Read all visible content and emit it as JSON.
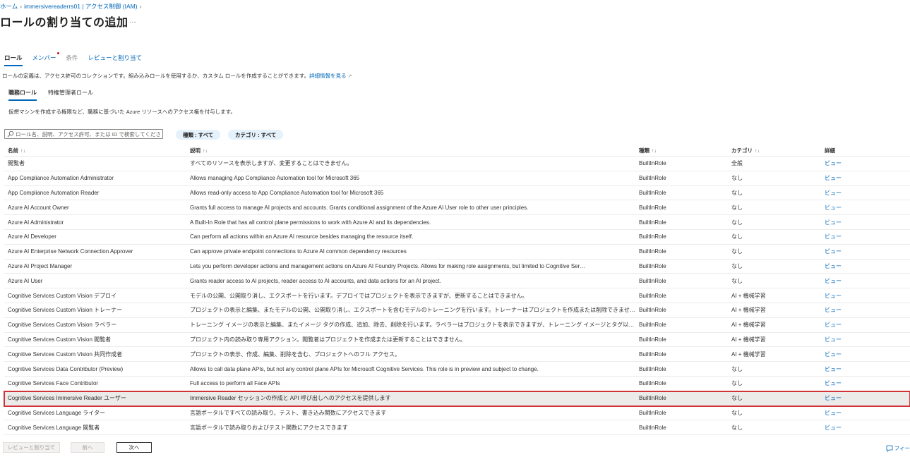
{
  "breadcrumb": {
    "home": "ホーム",
    "resource": "immersivereaderrs01 | アクセス制御 (IAM)"
  },
  "page": {
    "title": "ロールの割り当ての追加",
    "more": "…"
  },
  "tabs": [
    {
      "label": "ロール",
      "state": "active"
    },
    {
      "label": "メンバー",
      "state": "required"
    },
    {
      "label": "条件",
      "state": "disabled"
    },
    {
      "label": "レビューと割り当て",
      "state": "link"
    }
  ],
  "description": {
    "text": "ロールの定義は、アクセス許可のコレクションです。組み込みロールを使用するか、カスタム ロールを作成することができます。",
    "link": "詳細情報を見る"
  },
  "subtabs": [
    {
      "label": "職務ロール",
      "state": "active"
    },
    {
      "label": "特権管理者ロール",
      "state": "normal"
    }
  ],
  "sub_description": "仮想マシンを作成する権限など、職務に基づいた Azure リソースへのアクセス権を付与します。",
  "search": {
    "placeholder": "ロール名、説明、アクセス許可、または ID で検索してください"
  },
  "filters": {
    "type": "種類 : すべて",
    "category": "カテゴリ : すべて"
  },
  "table": {
    "columns": {
      "name": "名前",
      "description": "説明",
      "type": "種類",
      "category": "カテゴリ",
      "details": "詳細"
    },
    "sort_glyph": "↑↓",
    "rows": [
      {
        "name": "閲覧者",
        "description": "すべてのリソースを表示しますが、変更することはできません。",
        "type": "BuiltInRole",
        "category": "全般",
        "details": "ビュー"
      },
      {
        "name": "App Compliance Automation Administrator",
        "description": "Allows managing App Compliance Automation tool for Microsoft 365",
        "type": "BuiltInRole",
        "category": "なし",
        "details": "ビュー"
      },
      {
        "name": "App Compliance Automation Reader",
        "description": "Allows read-only access to App Compliance Automation tool for Microsoft 365",
        "type": "BuiltInRole",
        "category": "なし",
        "details": "ビュー"
      },
      {
        "name": "Azure AI Account Owner",
        "description": "Grants full access to manage AI projects and accounts. Grants conditional assignment of the Azure AI User role to other user principles.",
        "type": "BuiltInRole",
        "category": "なし",
        "details": "ビュー"
      },
      {
        "name": "Azure AI Administrator",
        "description": "A Built-In Role that has all control plane permissions to work with Azure AI and its dependencies.",
        "type": "BuiltInRole",
        "category": "なし",
        "details": "ビュー"
      },
      {
        "name": "Azure AI Developer",
        "description": "Can perform all actions within an Azure AI resource besides managing the resource itself.",
        "type": "BuiltInRole",
        "category": "なし",
        "details": "ビュー"
      },
      {
        "name": "Azure AI Enterprise Network Connection Approver",
        "description": "Can approve private endpoint connections to Azure AI common dependency resources",
        "type": "BuiltInRole",
        "category": "なし",
        "details": "ビュー"
      },
      {
        "name": "Azure AI Project Manager",
        "description": "Lets you perform developer actions and management actions on Azure AI Foundry Projects. Allows for making role assignments, but limited to Cognitive Ser…",
        "type": "BuiltInRole",
        "category": "なし",
        "details": "ビュー"
      },
      {
        "name": "Azure AI User",
        "description": "Grants reader access to AI projects, reader access to AI accounts, and data actions for an AI project.",
        "type": "BuiltInRole",
        "category": "なし",
        "details": "ビュー"
      },
      {
        "name": "Cognitive Services Custom Vision デプロイ",
        "description": "モデルの公開、公開取り消し、エクスポートを行います。デプロイではプロジェクトを表示できますが、更新することはできません。",
        "type": "BuiltInRole",
        "category": "AI + 機械学習",
        "details": "ビュー"
      },
      {
        "name": "Cognitive Services Custom Vision トレーナー",
        "description": "プロジェクトの表示と編集、またモデルの公開、公開取り消し、エクスポートを含むモデルのトレーニングを行います。トレーナーはプロジェクトを作成または削除できません。",
        "type": "BuiltInRole",
        "category": "AI + 機械学習",
        "details": "ビュー"
      },
      {
        "name": "Cognitive Services Custom Vision ラベラー",
        "description": "トレーニング イメージの表示と編集、またイメージ タグの作成、追加、除去、削除を行います。ラベラーはプロジェクトを表示できますが、トレーニング イメージとタグ以外は更新できません。",
        "type": "BuiltInRole",
        "category": "AI + 機械学習",
        "details": "ビュー"
      },
      {
        "name": "Cognitive Services Custom Vision 閲覧者",
        "description": "プロジェクト内の読み取り専用アクション。閲覧者はプロジェクトを作成または更新することはできません。",
        "type": "BuiltInRole",
        "category": "AI + 機械学習",
        "details": "ビュー"
      },
      {
        "name": "Cognitive Services Custom Vision 共同作成者",
        "description": "プロジェクトの表示、作成、編集、削除を含む、プロジェクトへのフル アクセス。",
        "type": "BuiltInRole",
        "category": "AI + 機械学習",
        "details": "ビュー"
      },
      {
        "name": "Cognitive Services Data Contributor (Preview)",
        "description": "Allows to call data plane APIs, but not any control plane APIs for Microsoft Cognitive Services. This role is in preview and subject to change.",
        "type": "BuiltInRole",
        "category": "なし",
        "details": "ビュー"
      },
      {
        "name": "Cognitive Services Face Contributor",
        "description": "Full access to perform all Face APIs",
        "type": "BuiltInRole",
        "category": "なし",
        "details": "ビュー"
      },
      {
        "name": "Cognitive Services Immersive Reader ユーザー",
        "description": "Immersive Reader セッションの作成と API 呼び出しへのアクセスを提供します",
        "type": "BuiltInRole",
        "category": "なし",
        "details": "ビュー",
        "selected": true
      },
      {
        "name": "Cognitive Services Language ライター",
        "description": "言語ポータルですべての読み取り、テスト、書き込み関数にアクセスできます",
        "type": "BuiltInRole",
        "category": "なし",
        "details": "ビュー"
      },
      {
        "name": "Cognitive Services Language 閲覧者",
        "description": "言語ポータルで読み取りおよびテスト関数にアクセスできます",
        "type": "BuiltInRole",
        "category": "なし",
        "details": "ビュー"
      }
    ]
  },
  "footer": {
    "review_button": "レビューと割り当て",
    "prev_button": "前へ",
    "next_button": "次へ",
    "feedback": "フィー"
  },
  "icons": {
    "search": "search-icon",
    "feedback": "feedback-icon",
    "external_link": "external-link-icon"
  },
  "colors": {
    "link": "#0067b8",
    "selected_row_border": "#d13438",
    "filter_pill_bg": "#e5f1fb",
    "required_dot": "#c50f1f"
  }
}
